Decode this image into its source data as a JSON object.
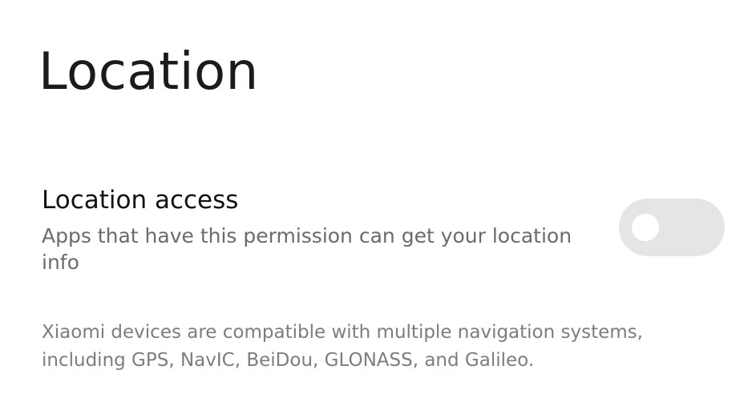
{
  "page": {
    "title": "Location"
  },
  "location_access": {
    "title": "Location access",
    "description": "Apps that have this permission can get your location info",
    "toggle": {
      "enabled": false,
      "track_color": "#e5e5e5",
      "knob_color": "#ffffff"
    }
  },
  "footnote": "Xiaomi devices are compatible with multiple navigation systems, including GPS, NavIC, BeiDou, GLONASS, and Galileo."
}
